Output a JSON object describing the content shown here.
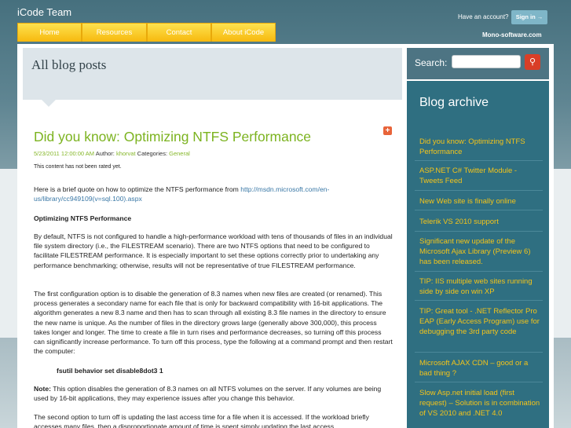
{
  "header": {
    "site_title": "iCode Team",
    "account_text": "Have an account?",
    "signin_label": "Sign in →",
    "domain": "Mono-software.com"
  },
  "nav": {
    "items": [
      {
        "label": "Home"
      },
      {
        "label": "Resources"
      },
      {
        "label": "Contact"
      },
      {
        "label": "About iCode"
      }
    ]
  },
  "main": {
    "heading": "All blog posts",
    "post": {
      "title": "Did you know: Optimizing NTFS Performance",
      "date": "5/23/2011 12:00:00 AM",
      "author_label": "Author:",
      "author": "khorvat",
      "categories_label": "Categories:",
      "category": "General",
      "rating": "This content has not been rated yet.",
      "intro": "Here is a brief quote on how to optimize the NTFS performance from",
      "link": "http://msdn.microsoft.com/en-us/library/cc949109(v=sql.100).aspx",
      "subheading": "Optimizing NTFS Performance",
      "para1": "By default, NTFS is not configured to handle a high-performance workload with tens of thousands of files in an individual file system directory (i.e., the FILESTREAM scenario). There are two NTFS options that need to be configured to facilitate FILESTREAM performance. It is especially important to set these options correctly prior to undertaking any performance benchmarking; otherwise, results will not be representative of true FILESTREAM performance.",
      "para2": "The first configuration option is to disable the generation of 8.3 names when new files are created (or renamed). This process generates a secondary name for each file that is only for backward compatibility with 16-bit applications. The algorithm generates a new 8.3 name and then has to scan through all existing 8.3 file names in the directory to ensure the new name is unique. As the number of files in the directory grows large (generally above 300,000), this process takes longer and longer. The time to create a file in turn rises and performance decreases, so turning off this process can significantly increase performance. To turn off this process, type the following at a command prompt and then restart the computer:",
      "command": "fsutil behavior set disable8dot3 1",
      "note_label": "Note:",
      "note_text": "This option disables the generation of 8.3 names on all NTFS volumes on the server. If any volumes are being used by 16-bit applications, they may experience issues after you change this behavior.",
      "para3": "The second option to turn off is updating the last access time for a file when it is accessed. If the workload briefly accesses many files, then a disproportionate amount of time is spent simply updating the last access"
    }
  },
  "sidebar": {
    "search_label": "Search:",
    "search_value": "",
    "archive_title": "Blog archive",
    "archive": [
      "Did you know: Optimizing NTFS Performance",
      "ASP.NET C# Twitter Module - Tweets Feed",
      "New Web site is finally online",
      "Telerik VS 2010 support",
      "Significant new update of the Microsoft Ajax Library (Preview 6) has been released.",
      "TIP: IIS multiple web sites running side by side on win XP",
      "TIP: Great tool - .NET Reflector Pro EAP (Early Access Program) use for debugging the 3rd party code",
      "Microsoft AJAX CDN – good or a bad thing ?",
      "Slow Asp.net initial load (first request) – Solution is in combination of VS 2010 and .NET 4.0"
    ]
  },
  "colors": {
    "accent_green": "#7cb320",
    "nav_yellow": "#f7b90e",
    "sidebar_teal": "#2f6f81",
    "archive_link": "#f4c41a"
  }
}
